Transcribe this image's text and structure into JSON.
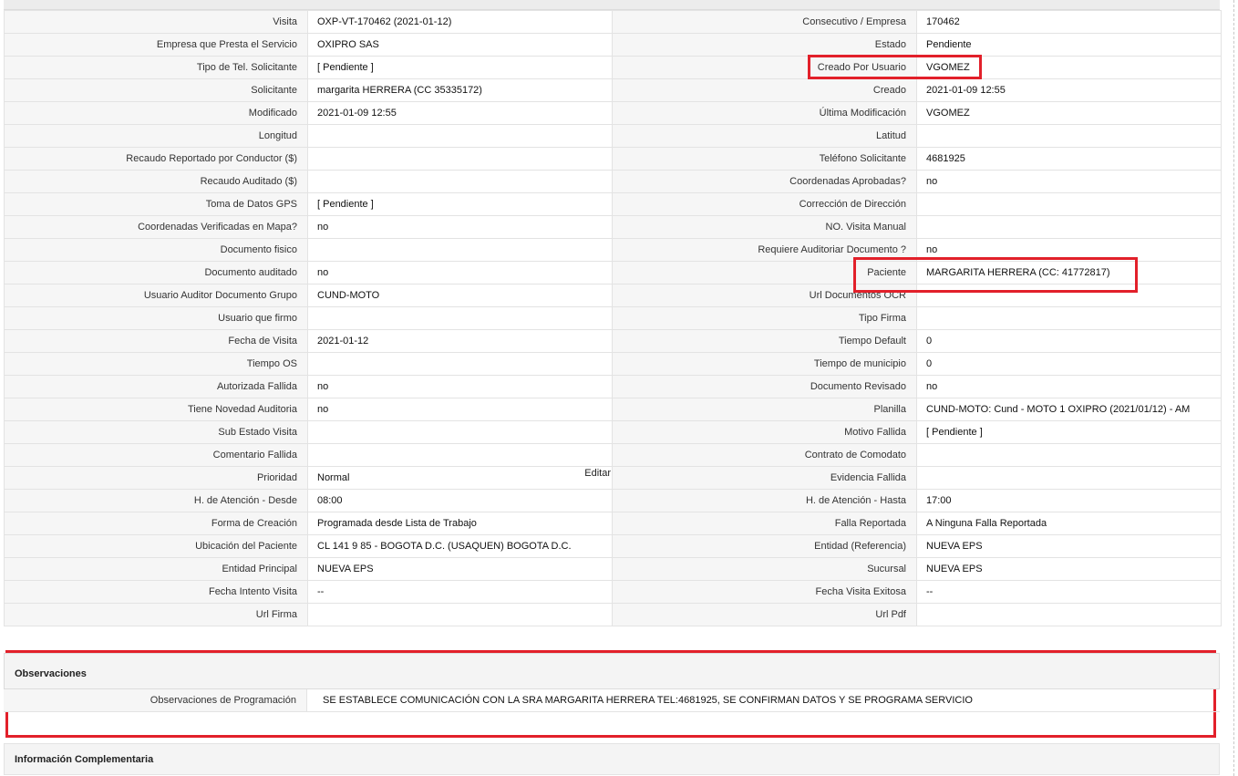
{
  "rows": [
    {
      "l1": "Visita",
      "v1": "OXP-VT-170462 (2021-01-12)",
      "l2": "Consecutivo / Empresa",
      "v2": "170462"
    },
    {
      "l1": "Empresa que Presta el Servicio",
      "v1": "OXIPRO SAS",
      "l2": "Estado",
      "v2": "Pendiente"
    },
    {
      "l1": "Tipo de Tel. Solicitante",
      "v1": "[ Pendiente ]",
      "l2": "Creado Por Usuario",
      "v2": "VGOMEZ"
    },
    {
      "l1": "Solicitante",
      "v1": "margarita HERRERA (CC 35335172)",
      "l2": "Creado",
      "v2": "2021-01-09 12:55"
    },
    {
      "l1": "Modificado",
      "v1": "2021-01-09 12:55",
      "l2": "Última Modificación",
      "v2": " VGOMEZ"
    },
    {
      "l1": "Longitud",
      "v1": "",
      "l2": "Latitud",
      "v2": ""
    },
    {
      "l1": "Recaudo Reportado por Conductor ($)",
      "v1": "",
      "l2": "Teléfono Solicitante",
      "v2": "4681925"
    },
    {
      "l1": "Recaudo Auditado ($)",
      "v1": "",
      "l2": "Coordenadas Aprobadas?",
      "v2": " no"
    },
    {
      "l1": "Toma de Datos GPS",
      "v1": "[ Pendiente ]",
      "l2": "Corrección de Dirección",
      "v2": ""
    },
    {
      "l1": "Coordenadas Verificadas en Mapa?",
      "v1": " no",
      "l2": "NO. Visita Manual",
      "v2": ""
    },
    {
      "l1": "Documento fisico",
      "v1": "",
      "l2": "Requiere Auditoriar Documento ?",
      "v2": " no"
    },
    {
      "l1": "Documento auditado",
      "v1": " no",
      "l2": "Paciente",
      "v2": "MARGARITA HERRERA (CC: 41772817)"
    },
    {
      "l1": "Usuario Auditor Documento Grupo",
      "v1": "CUND-MOTO",
      "l2": "Url Documentos OCR",
      "v2": ""
    },
    {
      "l1": "Usuario que firmo",
      "v1": "",
      "l2": "Tipo Firma",
      "v2": ""
    },
    {
      "l1": "Fecha de Visita",
      "v1": " 2021-01-12",
      "l2": "Tiempo Default",
      "v2": "0"
    },
    {
      "l1": "Tiempo OS",
      "v1": "",
      "l2": "Tiempo de municipio",
      "v2": "0"
    },
    {
      "l1": "Autorizada Fallida",
      "v1": " no",
      "l2": "Documento Revisado",
      "v2": " no"
    },
    {
      "l1": "Tiene Novedad Auditoria",
      "v1": " no",
      "l2": "Planilla",
      "v2": "CUND-MOTO: Cund - MOTO 1 OXIPRO (2021/01/12) - AM"
    },
    {
      "l1": "Sub Estado Visita",
      "v1": "",
      "l2": "Motivo Fallida",
      "v2": "[ Pendiente ]"
    },
    {
      "l1": "Comentario Fallida",
      "v1": "",
      "l2": "Contrato de Comodato",
      "v2": ""
    },
    {
      "l1": "Prioridad",
      "v1": "Normal",
      "l2": "Evidencia Fallida",
      "v2": ""
    },
    {
      "l1": "H. de Atención - Desde",
      "v1": "08:00",
      "l2": "H. de Atención - Hasta",
      "v2": "17:00"
    },
    {
      "l1": "Forma de Creación",
      "v1": "Programada desde Lista de Trabajo",
      "l2": "Falla Reportada",
      "v2": "A Ninguna Falla Reportada"
    },
    {
      "l1": "Ubicación del Paciente",
      "v1": "CL 141 9 85 - BOGOTA D.C. (USAQUEN) BOGOTA D.C.",
      "l2": "Entidad (Referencia)",
      "v2": "NUEVA EPS"
    },
    {
      "l1": "Entidad Principal",
      "v1": "NUEVA EPS",
      "l2": "Sucursal",
      "v2": "NUEVA EPS"
    },
    {
      "l1": "Fecha Intento Visita",
      "v1": " --",
      "l2": "Fecha Visita Exitosa",
      "v2": " --"
    },
    {
      "l1": "Url Firma",
      "v1": "",
      "l2": "Url Pdf",
      "v2": ""
    }
  ],
  "edit_label": "Editar",
  "observaciones": {
    "title": "Observaciones",
    "label": "Observaciones de Programación",
    "value": "SE ESTABLECE COMUNICACIÓN CON LA SRA MARGARITA HERRERA TEL:4681925, SE CONFIRMAN DATOS Y SE PROGRAMA SERVICIO"
  },
  "info_complementaria": {
    "title": "Información Complementaria"
  },
  "highlight_color": "#e2202a"
}
